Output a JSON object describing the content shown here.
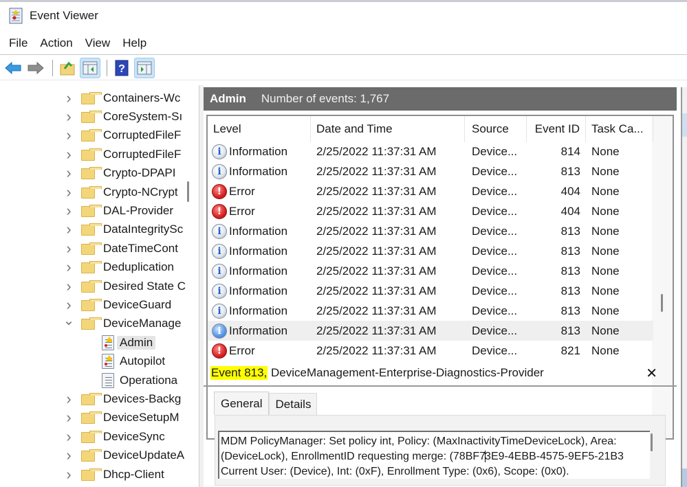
{
  "window": {
    "title": "Event Viewer",
    "icon": "event-viewer-icon"
  },
  "menu": [
    "File",
    "Action",
    "View",
    "Help"
  ],
  "toolbar": [
    {
      "name": "back-button",
      "icon": "arrow-left-icon"
    },
    {
      "name": "forward-button",
      "icon": "arrow-right-icon"
    },
    {
      "name": "open-saved-log-button",
      "icon": "folder-open-icon"
    },
    {
      "name": "show-hide-console-tree-button",
      "icon": "console-tree-icon",
      "pressed": true
    },
    {
      "name": "help-button",
      "icon": "help-icon"
    },
    {
      "name": "show-hide-action-pane-button",
      "icon": "action-pane-icon",
      "pressed": true
    }
  ],
  "tree": {
    "items": [
      {
        "label": "Containers-Wc",
        "type": "folder",
        "expanded": false
      },
      {
        "label": "CoreSystem-Sı",
        "type": "folder",
        "expanded": false
      },
      {
        "label": "CorruptedFileF",
        "type": "folder",
        "expanded": false
      },
      {
        "label": "CorruptedFileF",
        "type": "folder",
        "expanded": false
      },
      {
        "label": "Crypto-DPAPI",
        "type": "folder",
        "expanded": false
      },
      {
        "label": "Crypto-NCrypt",
        "type": "folder",
        "expanded": false
      },
      {
        "label": "DAL-Provider",
        "type": "folder",
        "expanded": false
      },
      {
        "label": "DataIntegritySc",
        "type": "folder",
        "expanded": false
      },
      {
        "label": "DateTimeCont",
        "type": "folder",
        "expanded": false
      },
      {
        "label": "Deduplication",
        "type": "folder",
        "expanded": false
      },
      {
        "label": "Desired State C",
        "type": "folder",
        "expanded": false
      },
      {
        "label": "DeviceGuard",
        "type": "folder",
        "expanded": false
      },
      {
        "label": "DeviceManage",
        "type": "folder",
        "expanded": true
      },
      {
        "label": "Admin",
        "type": "log",
        "warn": true,
        "selected": true
      },
      {
        "label": "Autopilot",
        "type": "log",
        "warn": true
      },
      {
        "label": "Operationa",
        "type": "log",
        "warn": false
      },
      {
        "label": "Devices-Backg",
        "type": "folder",
        "expanded": false
      },
      {
        "label": "DeviceSetupM",
        "type": "folder",
        "expanded": false
      },
      {
        "label": "DeviceSync",
        "type": "folder",
        "expanded": false
      },
      {
        "label": "DeviceUpdateA",
        "type": "folder",
        "expanded": false
      },
      {
        "label": "Dhcp-Client",
        "type": "folder",
        "expanded": false
      }
    ]
  },
  "log_header": {
    "title": "Admin",
    "count_label": "Number of events: 1,767"
  },
  "events": {
    "columns": [
      "Level",
      "Date and Time",
      "Source",
      "Event ID",
      "Task Ca..."
    ],
    "rows": [
      {
        "level": "Information",
        "date": "2/25/2022 11:37:31 AM",
        "source": "Device...",
        "event_id": "814",
        "task": "None"
      },
      {
        "level": "Information",
        "date": "2/25/2022 11:37:31 AM",
        "source": "Device...",
        "event_id": "813",
        "task": "None"
      },
      {
        "level": "Error",
        "date": "2/25/2022 11:37:31 AM",
        "source": "Device...",
        "event_id": "404",
        "task": "None"
      },
      {
        "level": "Error",
        "date": "2/25/2022 11:37:31 AM",
        "source": "Device...",
        "event_id": "404",
        "task": "None"
      },
      {
        "level": "Information",
        "date": "2/25/2022 11:37:31 AM",
        "source": "Device...",
        "event_id": "813",
        "task": "None"
      },
      {
        "level": "Information",
        "date": "2/25/2022 11:37:31 AM",
        "source": "Device...",
        "event_id": "813",
        "task": "None"
      },
      {
        "level": "Information",
        "date": "2/25/2022 11:37:31 AM",
        "source": "Device...",
        "event_id": "813",
        "task": "None"
      },
      {
        "level": "Information",
        "date": "2/25/2022 11:37:31 AM",
        "source": "Device...",
        "event_id": "813",
        "task": "None"
      },
      {
        "level": "Information",
        "date": "2/25/2022 11:37:31 AM",
        "source": "Device...",
        "event_id": "813",
        "task": "None"
      },
      {
        "level": "Information",
        "date": "2/25/2022 11:37:31 AM",
        "source": "Device...",
        "event_id": "813",
        "task": "None",
        "selected": true
      },
      {
        "level": "Error",
        "date": "2/25/2022 11:37:31 AM",
        "source": "Device...",
        "event_id": "821",
        "task": "None"
      }
    ]
  },
  "detail": {
    "title_highlight": "Event 813,",
    "title_rest": " DeviceManagement-Enterprise-Diagnostics-Provider",
    "close_glyph": "✕",
    "tabs": [
      "General",
      "Details"
    ],
    "active_tab": "General",
    "description_lines": [
      "MDM PolicyManager: Set policy int, Policy: (MaxInactivityTimeDeviceLock), Area:",
      "(DeviceLock), EnrollmentID requesting merge: (78BF7",
      "3E9-4EBB-4575-9EF5-21B3",
      "Current User: (Device), Int: (0xF), Enrollment Type: (0x6), Scope: (0x0)."
    ]
  },
  "colors": {
    "header_band": "#6b6b6b",
    "highlight": "#ffff00",
    "error_red": "#d72222",
    "info_blue": "#1c5fc9",
    "selection": "#efefef"
  }
}
